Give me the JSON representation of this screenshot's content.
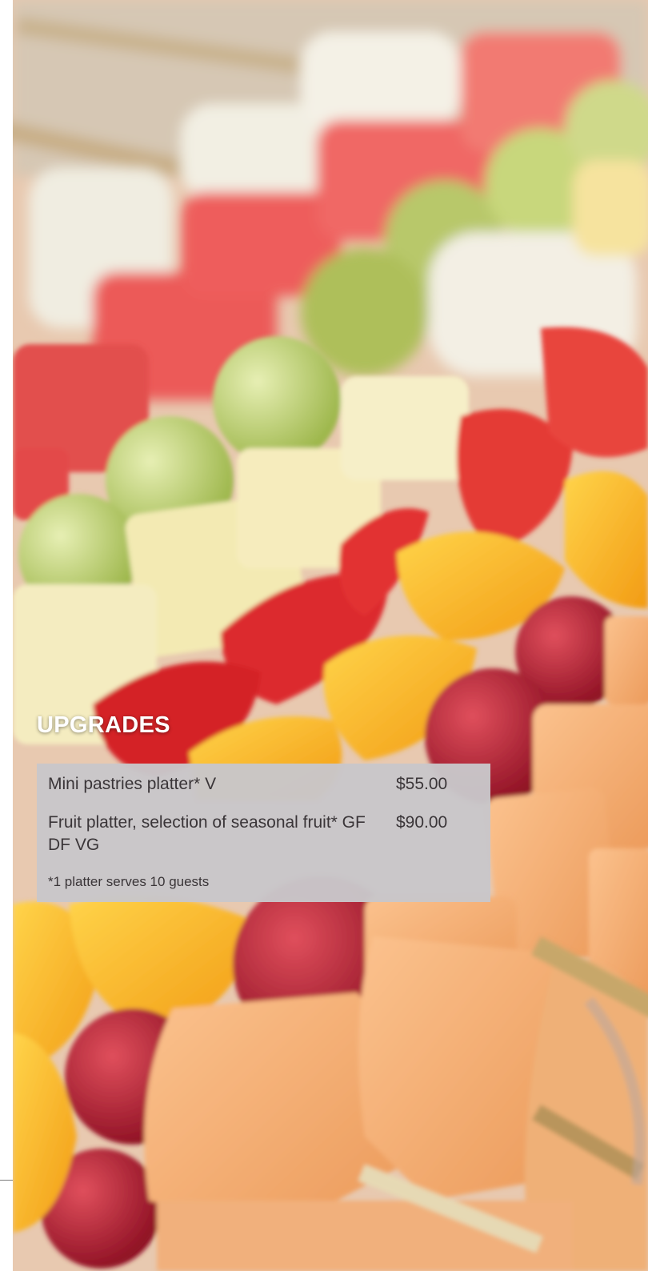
{
  "heading": "UPGRADES",
  "items": [
    {
      "name": "Mini pastries platter* V",
      "price": "$55.00"
    },
    {
      "name": "Fruit platter, selection of seasonal fruit* GF DF VG",
      "price": "$90.00"
    }
  ],
  "note": "*1 platter serves 10 guests",
  "colors": {
    "panel_background": "#c8c6c9",
    "panel_text": "#3a3538",
    "heading_text": "#ffffff"
  }
}
